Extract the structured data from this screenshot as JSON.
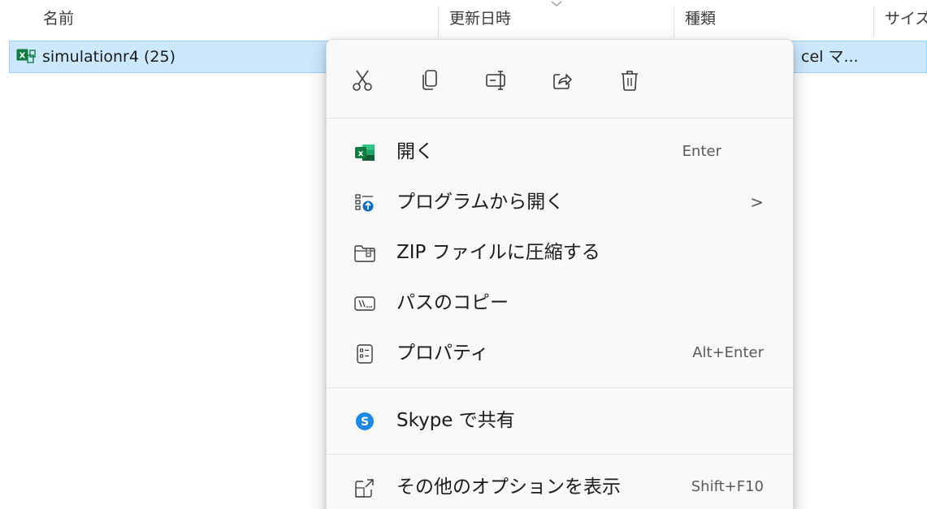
{
  "columns": {
    "name": "名前",
    "modified": "更新日時",
    "type": "種類",
    "size": "サイズ"
  },
  "file": {
    "name": "simulationr4 (25)",
    "type_truncated": "cel マ...",
    "icon": "excel-macro-file-icon"
  },
  "quick_actions": [
    {
      "name": "cut",
      "icon": "scissors-icon"
    },
    {
      "name": "copy",
      "icon": "copy-icon"
    },
    {
      "name": "rename",
      "icon": "rename-icon"
    },
    {
      "name": "share",
      "icon": "share-icon"
    },
    {
      "name": "delete",
      "icon": "trash-icon"
    }
  ],
  "menu": {
    "open": {
      "label": "開く",
      "shortcut": "Enter",
      "icon": "excel-icon"
    },
    "open_with": {
      "label": "プログラムから開く",
      "chevron": ">",
      "icon": "open-with-icon"
    },
    "zip": {
      "label": "ZIP ファイルに圧縮する",
      "icon": "zip-folder-icon"
    },
    "copy_path": {
      "label": "パスのコピー",
      "icon": "copy-path-icon"
    },
    "properties": {
      "label": "プロパティ",
      "shortcut": "Alt+Enter",
      "icon": "properties-icon"
    },
    "skype": {
      "label": "Skype で共有",
      "icon": "skype-icon"
    },
    "more_options": {
      "label": "その他のオプションを表示",
      "shortcut": "Shift+F10",
      "icon": "more-options-icon"
    }
  },
  "colors": {
    "selection_bg": "#cce8ff",
    "menu_bg": "#f9f9f9",
    "excel_green": "#107c41",
    "skype_blue": "#1e88e5"
  }
}
